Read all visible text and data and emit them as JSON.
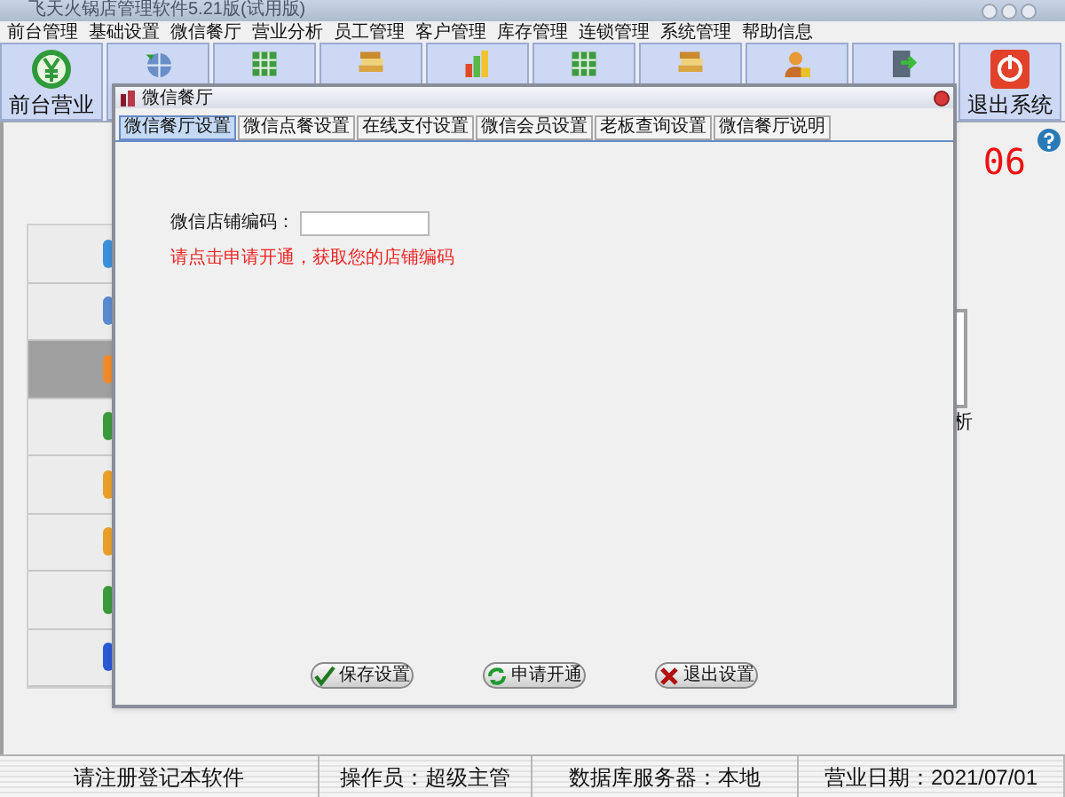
{
  "window": {
    "title": "飞天火锅店管理软件5.21版(试用版)"
  },
  "menu": [
    "前台管理",
    "基础设置",
    "微信餐厅",
    "营业分析",
    "员工管理",
    "客户管理",
    "库存管理",
    "连锁管理",
    "系统管理",
    "帮助信息"
  ],
  "toolbar": [
    {
      "kind": "labeled",
      "label": "前台营业"
    },
    {
      "kind": "icon"
    },
    {
      "kind": "icon"
    },
    {
      "kind": "icon"
    },
    {
      "kind": "icon"
    },
    {
      "kind": "icon"
    },
    {
      "kind": "icon"
    },
    {
      "kind": "icon"
    },
    {
      "kind": "icon"
    },
    {
      "kind": "labeled",
      "label": "退出系统"
    }
  ],
  "left_panel": {
    "items": [
      {
        "selected": false
      },
      {
        "selected": false
      },
      {
        "selected": true
      },
      {
        "selected": false
      },
      {
        "selected": false
      },
      {
        "selected": false
      },
      {
        "selected": false
      },
      {
        "selected": false
      }
    ]
  },
  "right_panel": {
    "number": "06",
    "card_label": "析"
  },
  "dialog": {
    "title": "微信餐厅",
    "tabs": [
      {
        "label": "微信餐厅设置",
        "selected": true
      },
      {
        "label": "微信点餐设置",
        "selected": false
      },
      {
        "label": "在线支付设置",
        "selected": false
      },
      {
        "label": "微信会员设置",
        "selected": false
      },
      {
        "label": "老板查询设置",
        "selected": false
      },
      {
        "label": "微信餐厅说明",
        "selected": false
      }
    ],
    "field_label": "微信店铺编码：",
    "notice": "请点击申请开通，获取您的店铺编码",
    "buttons": [
      {
        "kind": "save",
        "label": "保存设置"
      },
      {
        "kind": "apply",
        "label": "申请开通"
      },
      {
        "kind": "exit",
        "label": "退出设置"
      }
    ]
  },
  "status_bar": [
    "请注册登记本软件",
    "操作员：超级主管",
    "数据库服务器：本地",
    "营业日期：2021/07/01"
  ]
}
